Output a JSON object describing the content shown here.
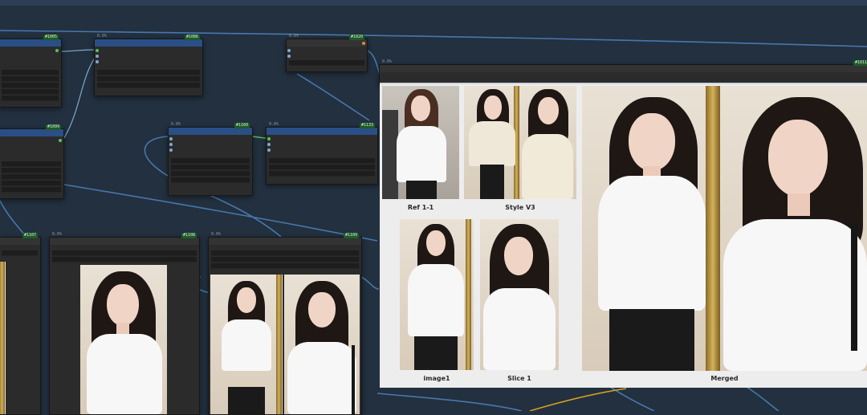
{
  "canvas": {
    "background": "#22303f",
    "wire_color": "#4d7fb8",
    "node_header_color": "#2a4f86"
  },
  "nodes": [
    {
      "id": "n1",
      "tag": "#1005",
      "mini": ""
    },
    {
      "id": "n2",
      "tag": "#1086",
      "mini": "0.0%"
    },
    {
      "id": "n3",
      "tag": "#1020",
      "mini": "0.0%"
    },
    {
      "id": "n4",
      "tag": "#1099",
      "mini": ""
    },
    {
      "id": "n5",
      "tag": "#1160",
      "mini": "0.0%"
    },
    {
      "id": "n6",
      "tag": "#1133",
      "mini": "0.0%"
    },
    {
      "id": "n7",
      "tag": "#1107",
      "mini": ""
    },
    {
      "id": "n8",
      "tag": "#1108",
      "mini": "0.0%"
    },
    {
      "id": "n9",
      "tag": "#1109",
      "mini": "0.0%"
    },
    {
      "id": "n10",
      "tag": "#1011",
      "mini": "0.0%"
    }
  ],
  "preview": {
    "captions": {
      "ref_image": "Ref 1-1",
      "style_v3": "Style V3",
      "image1": "image1",
      "slice1": "Slice 1",
      "merged": "Merged"
    }
  }
}
